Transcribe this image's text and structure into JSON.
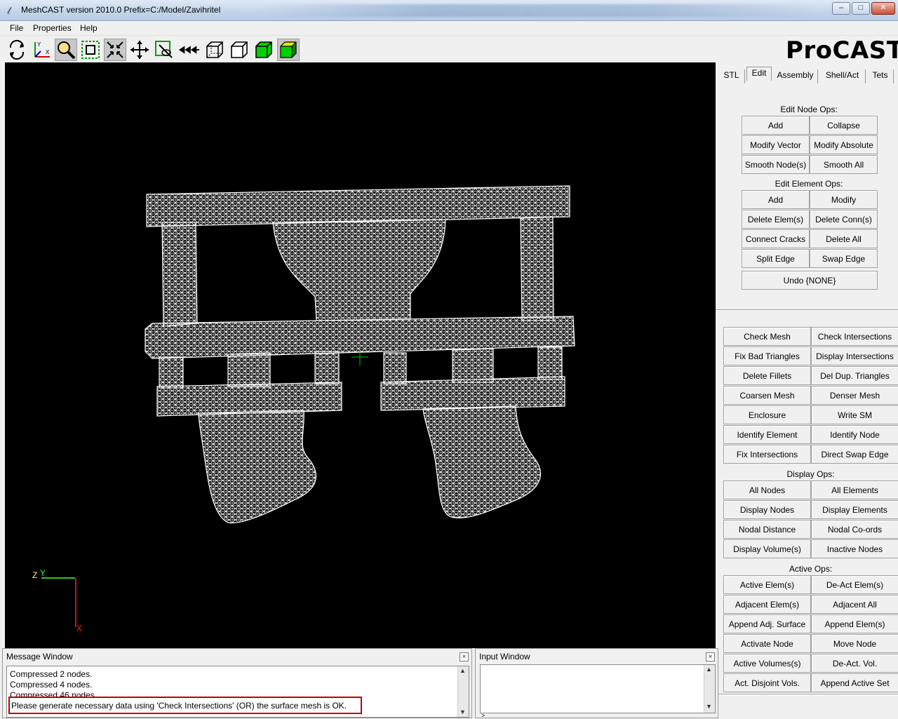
{
  "window": {
    "title": "MeshCAST version 2010.0   Prefix=C:/Model/Zavihritel",
    "minimize": "–",
    "maximize": "□",
    "close": "✕"
  },
  "menu": {
    "items": [
      "File",
      "Properties",
      "Help"
    ]
  },
  "toolbar": {
    "tools": [
      "rotate-icon",
      "axes-icon",
      "zoom-icon",
      "zoom-box-icon",
      "fit-view-icon",
      "pan-icon",
      "pick-icon",
      "rewind-icon",
      "wireframe-icon",
      "outline-icon",
      "solid-green-icon",
      "solid-shaded-icon"
    ]
  },
  "logo": "ProCAST",
  "tabs": [
    "STL",
    "Edit",
    "Assembly",
    "Shell/Act",
    "Tets"
  ],
  "edit_panel": {
    "node_ops_label": "Edit Node Ops:",
    "node_ops": [
      "Add",
      "Collapse",
      "Modify Vector",
      "Modify Absolute",
      "Smooth Node(s)",
      "Smooth All"
    ],
    "element_ops_label": "Edit Element Ops:",
    "element_ops": [
      "Add",
      "Modify",
      "Delete Elem(s)",
      "Delete Conn(s)",
      "Connect Cracks",
      "Delete All",
      "Split Edge",
      "Swap Edge"
    ],
    "undo_label": "Undo {NONE}"
  },
  "mesh_ops": [
    "Check Mesh",
    "Check Intersections",
    "Fix Bad Triangles",
    "Display Intersections",
    "Delete Fillets",
    "Del Dup. Triangles",
    "Coarsen Mesh",
    "Denser Mesh",
    "Enclosure",
    "Write SM",
    "Identify Element",
    "Identify Node",
    "Fix Intersections",
    "Direct Swap Edge"
  ],
  "display_ops_label": "Display Ops:",
  "display_ops": [
    "All Nodes",
    "All Elements",
    "Display Nodes",
    "Display Elements",
    "Nodal Distance",
    "Nodal Co-ords",
    "Display Volume(s)",
    "Inactive Nodes"
  ],
  "active_ops_label": "Active Ops:",
  "active_ops": [
    "Active Elem(s)",
    "De-Act Elem(s)",
    "Adjacent Elem(s)",
    "Adjacent All",
    "Append Adj. Surface",
    "Append Elem(s)",
    "Activate Node",
    "Move Node",
    "Active Volumes(s)",
    "De-Act. Vol.",
    "Act. Disjoint Vols.",
    "Append Active Set"
  ],
  "axes": {
    "z": "Z",
    "y": "Y",
    "x": "X"
  },
  "message_window": {
    "title": "Message Window",
    "lines": [
      "Compressed 2 nodes.",
      "Compressed 4 nodes.",
      "Compressed 46 nodes."
    ],
    "highlighted": "Please generate necessary data using 'Check Intersections' (OR) the surface mesh is OK."
  },
  "input_window": {
    "title": "Input Window",
    "prompt": ">"
  },
  "colors": {
    "viewport_bg": "#000000",
    "mesh": "#ffffff",
    "highlight_border": "#c00000",
    "axis_x": "#ff2020",
    "axis_y": "#40ff40",
    "axis_z": "#ffff40"
  }
}
